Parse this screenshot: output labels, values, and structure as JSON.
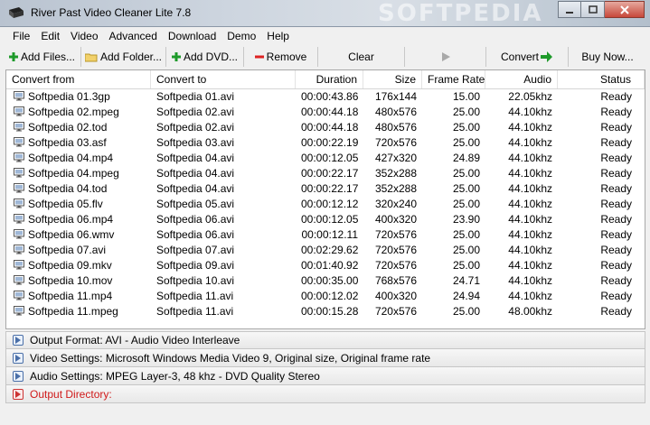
{
  "window": {
    "title": "River Past Video Cleaner Lite 7.8",
    "watermark": "SOFTPEDIA"
  },
  "menu": [
    "File",
    "Edit",
    "Video",
    "Advanced",
    "Download",
    "Demo",
    "Help"
  ],
  "toolbar": {
    "add_files": "Add Files...",
    "add_folder": "Add Folder...",
    "add_dvd": "Add DVD...",
    "remove": "Remove",
    "clear": "Clear",
    "convert": "Convert",
    "buy_now": "Buy Now..."
  },
  "columns": [
    "Convert from",
    "Convert to",
    "Duration",
    "Size",
    "Frame Rate",
    "Audio",
    "Status"
  ],
  "rows": [
    {
      "from": "Softpedia 01.3gp",
      "to": "Softpedia 01.avi",
      "duration": "00:00:43.86",
      "size": "176x144",
      "fps": "15.00",
      "audio": "22.05khz",
      "status": "Ready"
    },
    {
      "from": "Softpedia 02.mpeg",
      "to": "Softpedia 02.avi",
      "duration": "00:00:44.18",
      "size": "480x576",
      "fps": "25.00",
      "audio": "44.10khz",
      "status": "Ready"
    },
    {
      "from": "Softpedia 02.tod",
      "to": "Softpedia 02.avi",
      "duration": "00:00:44.18",
      "size": "480x576",
      "fps": "25.00",
      "audio": "44.10khz",
      "status": "Ready"
    },
    {
      "from": "Softpedia 03.asf",
      "to": "Softpedia 03.avi",
      "duration": "00:00:22.19",
      "size": "720x576",
      "fps": "25.00",
      "audio": "44.10khz",
      "status": "Ready"
    },
    {
      "from": "Softpedia 04.mp4",
      "to": "Softpedia 04.avi",
      "duration": "00:00:12.05",
      "size": "427x320",
      "fps": "24.89",
      "audio": "44.10khz",
      "status": "Ready"
    },
    {
      "from": "Softpedia 04.mpeg",
      "to": "Softpedia 04.avi",
      "duration": "00:00:22.17",
      "size": "352x288",
      "fps": "25.00",
      "audio": "44.10khz",
      "status": "Ready"
    },
    {
      "from": "Softpedia 04.tod",
      "to": "Softpedia 04.avi",
      "duration": "00:00:22.17",
      "size": "352x288",
      "fps": "25.00",
      "audio": "44.10khz",
      "status": "Ready"
    },
    {
      "from": "Softpedia 05.flv",
      "to": "Softpedia 05.avi",
      "duration": "00:00:12.12",
      "size": "320x240",
      "fps": "25.00",
      "audio": "44.10khz",
      "status": "Ready"
    },
    {
      "from": "Softpedia 06.mp4",
      "to": "Softpedia 06.avi",
      "duration": "00:00:12.05",
      "size": "400x320",
      "fps": "23.90",
      "audio": "44.10khz",
      "status": "Ready"
    },
    {
      "from": "Softpedia 06.wmv",
      "to": "Softpedia 06.avi",
      "duration": "00:00:12.11",
      "size": "720x576",
      "fps": "25.00",
      "audio": "44.10khz",
      "status": "Ready"
    },
    {
      "from": "Softpedia 07.avi",
      "to": "Softpedia 07.avi",
      "duration": "00:02:29.62",
      "size": "720x576",
      "fps": "25.00",
      "audio": "44.10khz",
      "status": "Ready"
    },
    {
      "from": "Softpedia 09.mkv",
      "to": "Softpedia 09.avi",
      "duration": "00:01:40.92",
      "size": "720x576",
      "fps": "25.00",
      "audio": "44.10khz",
      "status": "Ready"
    },
    {
      "from": "Softpedia 10.mov",
      "to": "Softpedia 10.avi",
      "duration": "00:00:35.00",
      "size": "768x576",
      "fps": "24.71",
      "audio": "44.10khz",
      "status": "Ready"
    },
    {
      "from": "Softpedia 11.mp4",
      "to": "Softpedia 11.avi",
      "duration": "00:00:12.02",
      "size": "400x320",
      "fps": "24.94",
      "audio": "44.10khz",
      "status": "Ready"
    },
    {
      "from": "Softpedia 11.mpeg",
      "to": "Softpedia 11.avi",
      "duration": "00:00:15.28",
      "size": "720x576",
      "fps": "25.00",
      "audio": "48.00khz",
      "status": "Ready"
    }
  ],
  "panels": {
    "output_format": "Output Format: AVI - Audio Video Interleave",
    "video_settings": "Video Settings: Microsoft Windows Media Video 9, Original size, Original frame rate",
    "audio_settings": "Audio Settings: MPEG Layer-3, 48 khz - DVD Quality Stereo",
    "output_directory": "Output Directory:"
  },
  "colors": {
    "accent_red": "#d01a1a",
    "add_green": "#1e9a2a",
    "remove_red": "#d22"
  }
}
